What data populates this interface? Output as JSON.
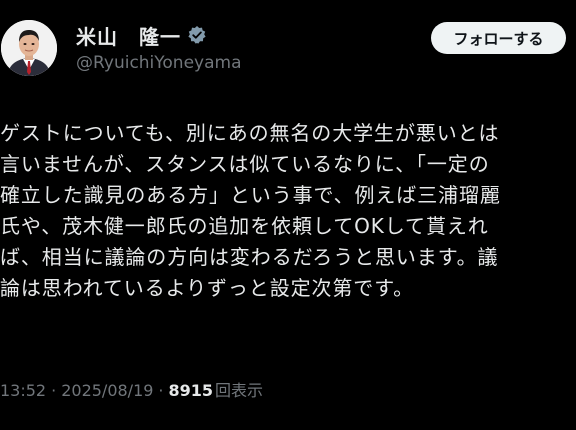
{
  "author": {
    "display_name": "米山　隆一",
    "handle": "@RyuichiYoneyama",
    "verified_icon": "verified-badge-icon",
    "avatar_icon": "avatar-photo"
  },
  "follow_button": {
    "label": "フォローする"
  },
  "tweet": {
    "lines": [
      "ゲストについても、別にあの無名の大学生が悪いとは",
      "言いませんが、スタンスは似ているなりに、「一定の",
      "確立した識見のある方」という事で、例えば三浦瑠麗",
      "氏や、茂木健一郎氏の追加を依頼してOKして貰えれ",
      "ば、相当に議論の方向は変わるだろうと思います。議",
      "論は思われているよりずっと設定次第です。"
    ]
  },
  "meta": {
    "time": "13:52",
    "separator": "·",
    "date": "2025/08/19",
    "views_count": "8915",
    "views_label": "回表示"
  },
  "colors": {
    "background": "#000000",
    "text": "#e7e9ea",
    "secondary": "#71767b",
    "verified": "#829aab",
    "button_bg": "#eff3f4"
  }
}
